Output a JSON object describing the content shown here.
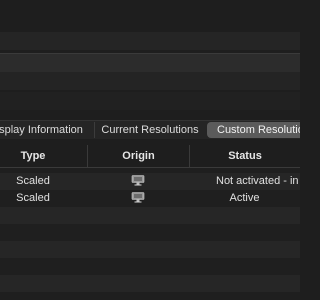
{
  "tabs": [
    {
      "label": "splay Information"
    },
    {
      "label": "Current Resolutions"
    },
    {
      "label": "Custom Resolutio"
    }
  ],
  "table": {
    "headers": [
      "Type",
      "Origin",
      "Status"
    ],
    "rows": [
      {
        "type": "Scaled",
        "origin_icon": "display-icon",
        "status": "Not activated - in"
      },
      {
        "type": "Scaled",
        "origin_icon": "display-icon",
        "status": "Active"
      }
    ]
  }
}
